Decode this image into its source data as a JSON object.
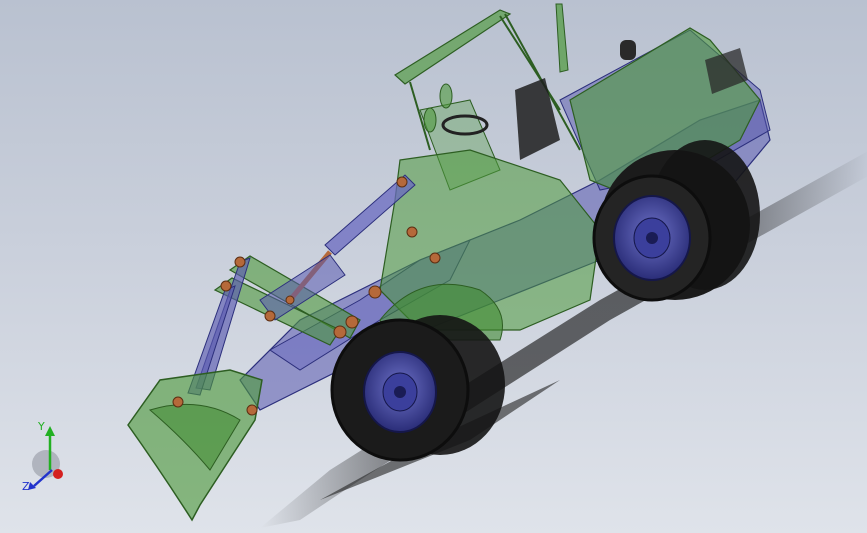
{
  "viewport": {
    "background_top": "#b9c1d0",
    "background_bottom": "#dfe3ea",
    "colors": {
      "body_green": "#4e9a3c",
      "frame_blue": "#5a5ab0",
      "tire_black": "#1b1b1b",
      "hub_navy": "#2c2f7c",
      "pivot_copper": "#b5693a"
    },
    "model_icon": "wheel-loader-model"
  },
  "triad": {
    "y_label": "Y",
    "z_label": "Z",
    "y_color": "#22b022",
    "z_color": "#2233cc",
    "x_color": "#d42020"
  }
}
